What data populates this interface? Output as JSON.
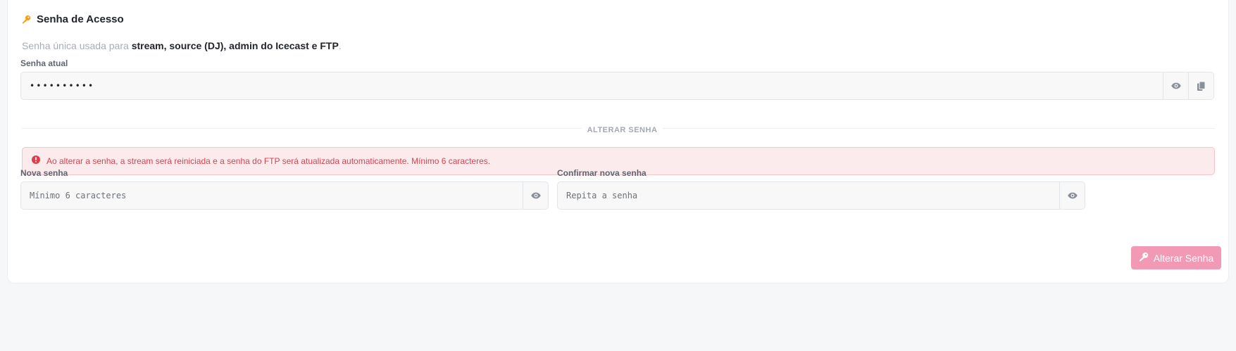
{
  "section": {
    "title": "Senha de Acesso",
    "icon": "key-icon",
    "description_prefix": "Senha única usada para",
    "description_strong": "stream, source (DJ), admin do Icecast e FTP",
    "description_suffix": "."
  },
  "current_password": {
    "label": "Senha atual",
    "value": "••••••••••",
    "show_icon": "eye-icon",
    "copy_icon": "copy-icon"
  },
  "change_section": {
    "divider_label": "ALTERAR SENHA",
    "alert_icon": "alert-circle-icon",
    "alert_text": "Ao alterar a senha, a stream será reiniciada e a senha do FTP será atualizada automaticamente. Mínimo 6 caracteres."
  },
  "new_password": {
    "label": "Nova senha",
    "placeholder": "Mínimo 6 caracteres",
    "show_icon": "eye-icon"
  },
  "confirm_password": {
    "label": "Confirmar nova senha",
    "placeholder": "Repita a senha",
    "show_icon": "eye-icon"
  },
  "submit": {
    "label": "Alterar Senha",
    "icon": "key-icon"
  },
  "colors": {
    "accent": "#f29ab5",
    "alert_bg": "#fcebed",
    "alert_text": "#d9414f",
    "key_icon": "#f0a020"
  }
}
